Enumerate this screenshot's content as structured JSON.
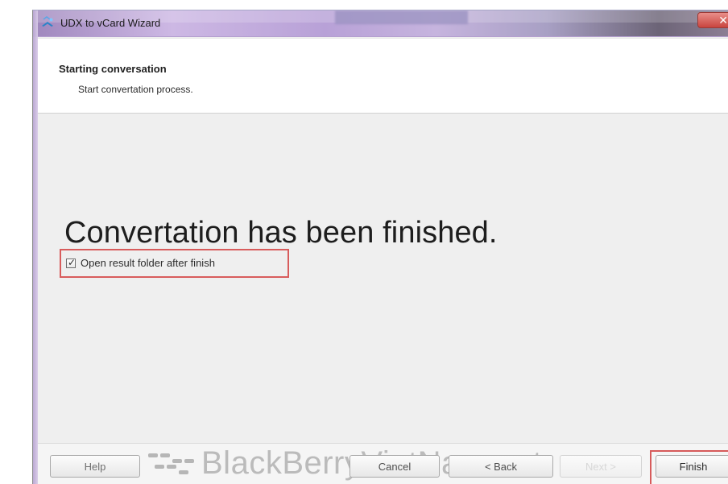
{
  "window": {
    "title": "UDX to vCard Wizard",
    "icon": "wizard-icon",
    "close_icon": "close-icon"
  },
  "header": {
    "title": "Starting conversation",
    "subtitle": "Start convertation process."
  },
  "main": {
    "result_text": "Convertation has been finished.",
    "checkbox": {
      "label": "Open result folder after finish",
      "checked": true
    }
  },
  "footer": {
    "help_label": "Help",
    "cancel_label": "Cancel",
    "back_label": "< Back",
    "next_label": "Next >",
    "finish_label": "Finish"
  },
  "watermark": {
    "text": "BlackBerryVietNam.net",
    "icon": "blackberry-logo-icon"
  },
  "colors": {
    "highlight": "#d85c5c",
    "title_bar": "#b8a1d7",
    "close_button": "#c9453f"
  }
}
